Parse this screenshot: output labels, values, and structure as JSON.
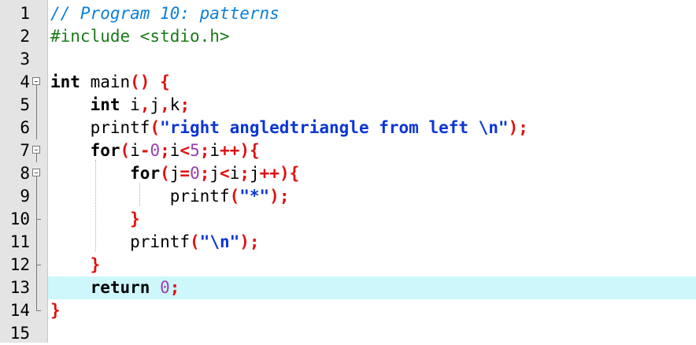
{
  "editor": {
    "current_line": 13,
    "colors": {
      "gutter_bg": "#e4e4e4",
      "current_line_bg": "#cdf7fb",
      "comment": "#0a7fd8",
      "preprocessor": "#1a7a1a",
      "operator": "#e01010",
      "string": "#0b36d6",
      "number": "#9a3fb4"
    },
    "lines": [
      {
        "n": "1",
        "fold": "",
        "tokens": [
          {
            "t": "// Program 10: patterns",
            "c": "cm"
          }
        ]
      },
      {
        "n": "2",
        "fold": "",
        "tokens": [
          {
            "t": "#include <stdio.h>",
            "c": "pp"
          }
        ]
      },
      {
        "n": "3",
        "fold": "",
        "tokens": []
      },
      {
        "n": "4",
        "fold": "open",
        "tokens": [
          {
            "t": "int",
            "c": "kw"
          },
          {
            "t": " main",
            "c": "id"
          },
          {
            "t": "() {",
            "c": "op"
          }
        ]
      },
      {
        "n": "5",
        "fold": "",
        "tokens": [
          {
            "t": "    ",
            "c": "id"
          },
          {
            "t": "int",
            "c": "kw"
          },
          {
            "t": " i",
            "c": "id"
          },
          {
            "t": ",",
            "c": "op"
          },
          {
            "t": "j",
            "c": "id"
          },
          {
            "t": ",",
            "c": "op"
          },
          {
            "t": "k",
            "c": "id"
          },
          {
            "t": ";",
            "c": "op"
          }
        ]
      },
      {
        "n": "6",
        "fold": "",
        "tokens": [
          {
            "t": "    printf",
            "c": "id"
          },
          {
            "t": "(",
            "c": "op"
          },
          {
            "t": "\"right angledtriangle from left \\n\"",
            "c": "str"
          },
          {
            "t": ");",
            "c": "op"
          }
        ]
      },
      {
        "n": "7",
        "fold": "open",
        "tokens": [
          {
            "t": "    ",
            "c": "id"
          },
          {
            "t": "for",
            "c": "kw"
          },
          {
            "t": "(",
            "c": "op"
          },
          {
            "t": "i",
            "c": "id"
          },
          {
            "t": "-",
            "c": "op"
          },
          {
            "t": "0",
            "c": "num"
          },
          {
            "t": ";",
            "c": "op"
          },
          {
            "t": "i",
            "c": "id"
          },
          {
            "t": "<",
            "c": "op"
          },
          {
            "t": "5",
            "c": "num"
          },
          {
            "t": ";",
            "c": "op"
          },
          {
            "t": "i",
            "c": "id"
          },
          {
            "t": "++){",
            "c": "op"
          }
        ]
      },
      {
        "n": "8",
        "fold": "open",
        "tokens": [
          {
            "t": "        ",
            "c": "id"
          },
          {
            "t": "for",
            "c": "kw"
          },
          {
            "t": "(",
            "c": "op"
          },
          {
            "t": "j",
            "c": "id"
          },
          {
            "t": "=",
            "c": "op"
          },
          {
            "t": "0",
            "c": "num"
          },
          {
            "t": ";",
            "c": "op"
          },
          {
            "t": "j",
            "c": "id"
          },
          {
            "t": "<",
            "c": "op"
          },
          {
            "t": "i",
            "c": "id"
          },
          {
            "t": ";",
            "c": "op"
          },
          {
            "t": "j",
            "c": "id"
          },
          {
            "t": "++){",
            "c": "op"
          }
        ]
      },
      {
        "n": "9",
        "fold": "",
        "tokens": [
          {
            "t": "            printf",
            "c": "id"
          },
          {
            "t": "(",
            "c": "op"
          },
          {
            "t": "\"*\"",
            "c": "str"
          },
          {
            "t": ");",
            "c": "op"
          }
        ]
      },
      {
        "n": "10",
        "fold": "end",
        "tokens": [
          {
            "t": "        ",
            "c": "id"
          },
          {
            "t": "}",
            "c": "op"
          }
        ]
      },
      {
        "n": "11",
        "fold": "",
        "tokens": [
          {
            "t": "        printf",
            "c": "id"
          },
          {
            "t": "(",
            "c": "op"
          },
          {
            "t": "\"\\n\"",
            "c": "str"
          },
          {
            "t": ");",
            "c": "op"
          }
        ]
      },
      {
        "n": "12",
        "fold": "end",
        "tokens": [
          {
            "t": "    ",
            "c": "id"
          },
          {
            "t": "}",
            "c": "op"
          }
        ]
      },
      {
        "n": "13",
        "fold": "",
        "tokens": [
          {
            "t": "    ",
            "c": "id"
          },
          {
            "t": "return",
            "c": "kw"
          },
          {
            "t": " ",
            "c": "id"
          },
          {
            "t": "0",
            "c": "num"
          },
          {
            "t": ";",
            "c": "op"
          }
        ]
      },
      {
        "n": "14",
        "fold": "end",
        "tokens": [
          {
            "t": "}",
            "c": "op"
          }
        ]
      },
      {
        "n": "15",
        "fold": "",
        "tokens": []
      }
    ]
  }
}
